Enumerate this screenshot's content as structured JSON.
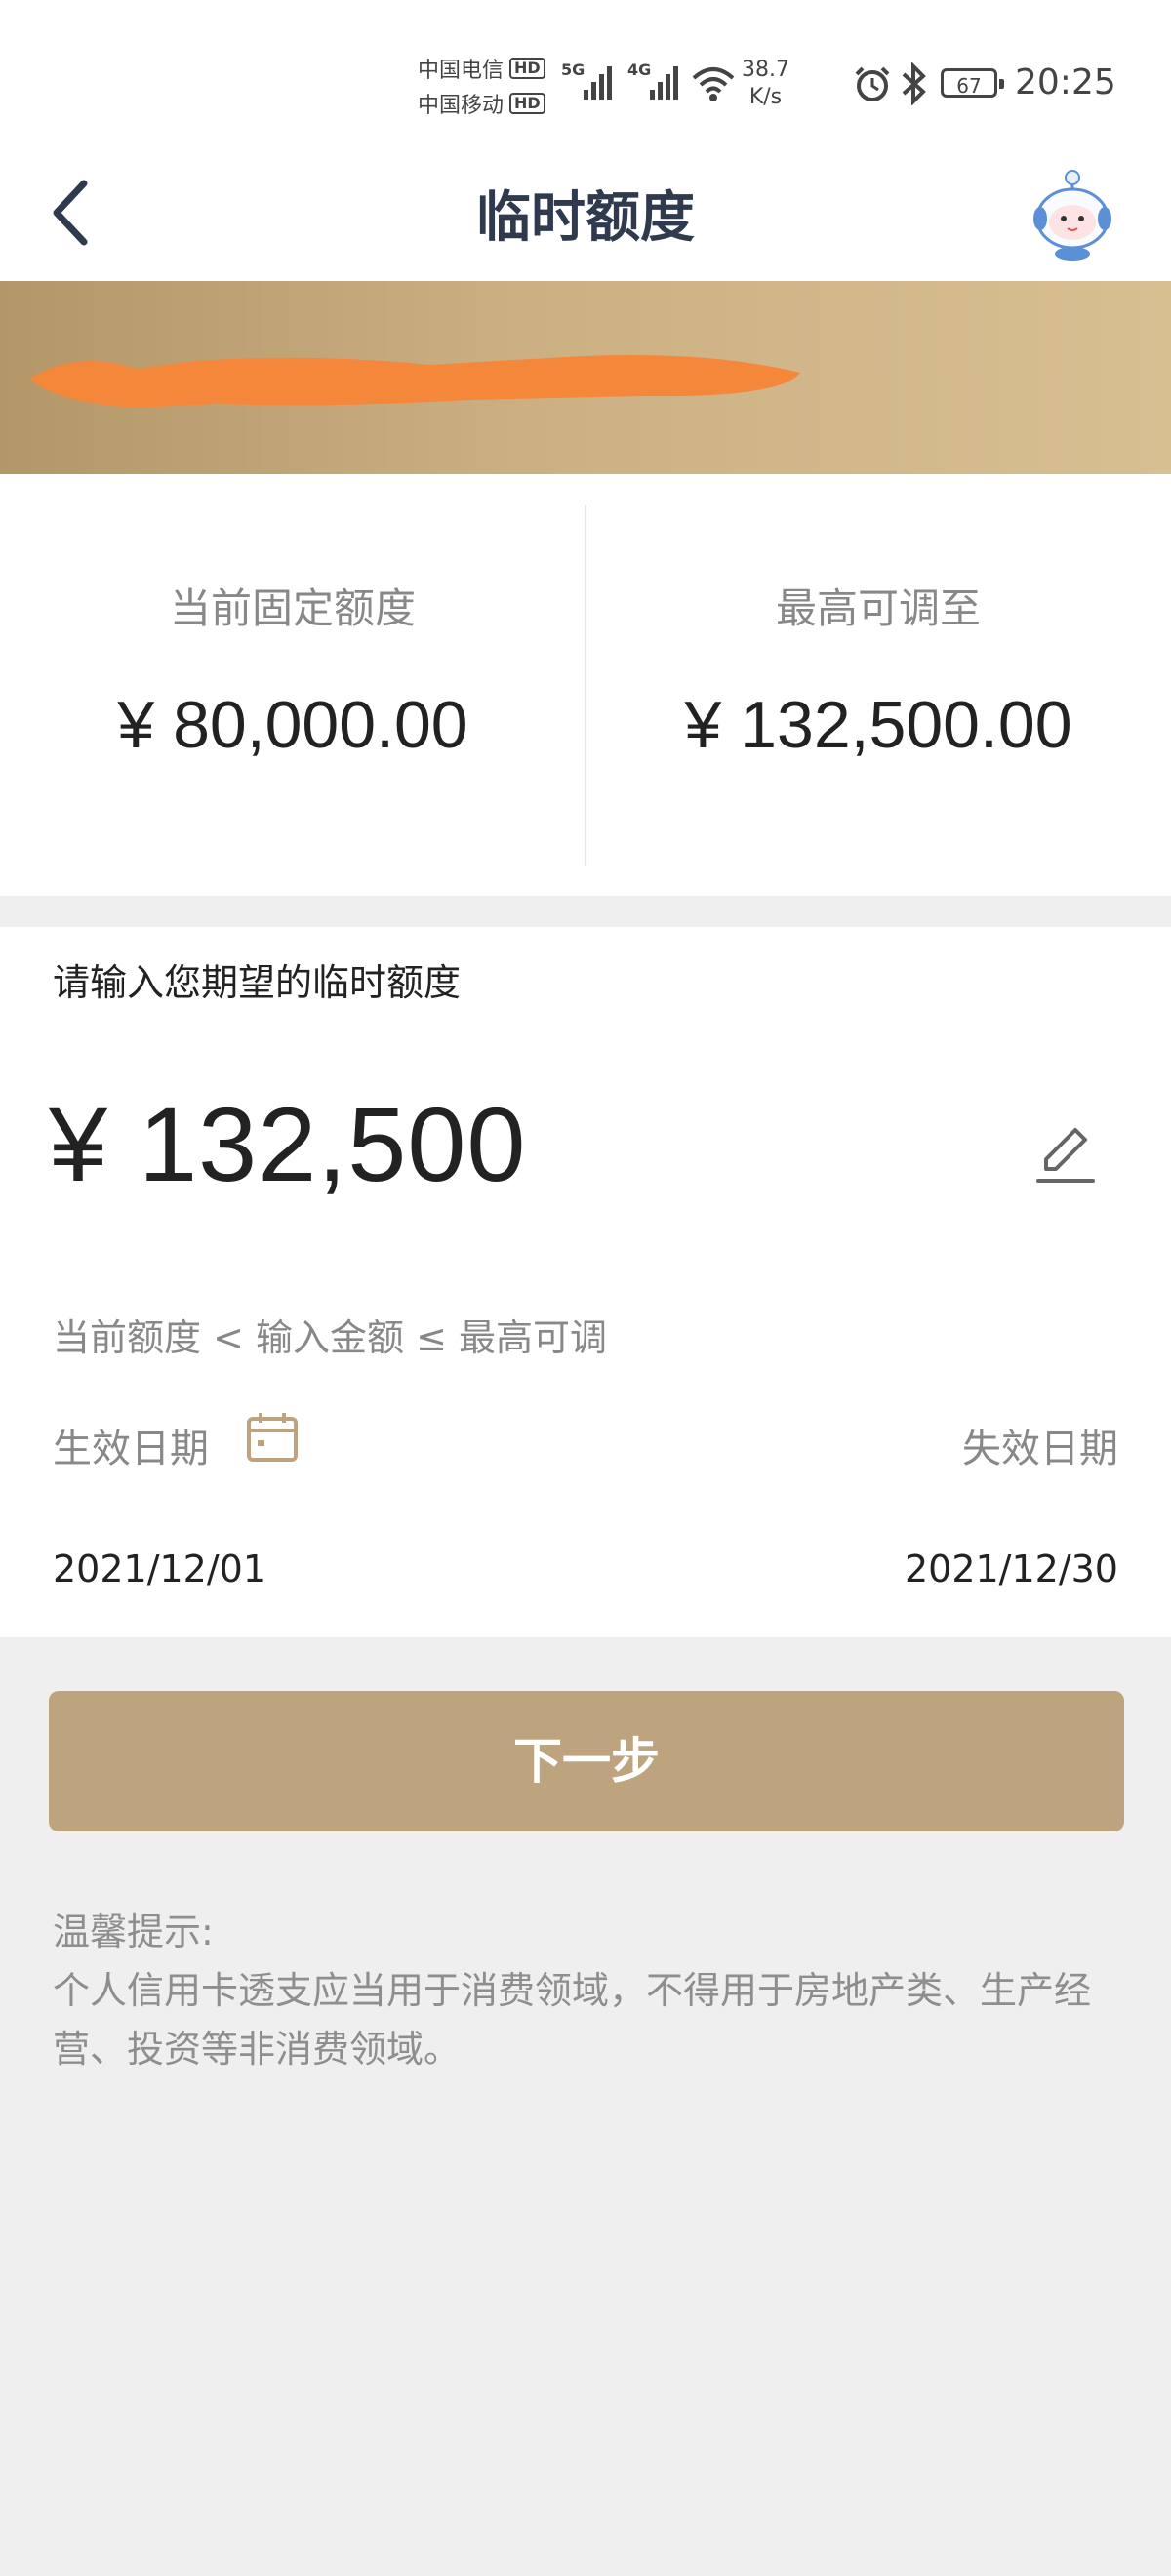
{
  "status_bar": {
    "carrier1": "中国电信",
    "carrier2": "中国移动",
    "hd": "HD",
    "net1": "5G",
    "net2": "4G",
    "speed_value": "38.7",
    "speed_unit": "K/s",
    "battery": "67",
    "time": "20:25"
  },
  "header": {
    "title": "临时额度"
  },
  "limits": {
    "current_label": "当前固定额度",
    "current_value": "¥ 80,000.00",
    "max_label": "最高可调至",
    "max_value": "¥ 132,500.00"
  },
  "input": {
    "prompt": "请输入您期望的临时额度",
    "amount": "¥ 132,500",
    "rule": "当前额度 < 输入金额 ≤ 最高可调",
    "effective_label": "生效日期",
    "expiry_label": "失效日期",
    "effective_date": "2021/12/01",
    "expiry_date": "2021/12/30"
  },
  "next_button": "下一步",
  "tips": {
    "title": "温馨提示:",
    "body": "个人信用卡透支应当用于消费领域，不得用于房地产类、生产经营、投资等非消费领域。"
  },
  "colors": {
    "accent": "#bda47e",
    "banner_start": "#b39769",
    "banner_end": "#d8bf92",
    "title": "#2f3a4f"
  },
  "icons": [
    "back-arrow-icon",
    "robot-assistant-icon",
    "edit-pencil-icon",
    "calendar-icon",
    "alarm-icon",
    "bluetooth-icon",
    "wifi-icon",
    "signal-icon",
    "battery-icon"
  ]
}
